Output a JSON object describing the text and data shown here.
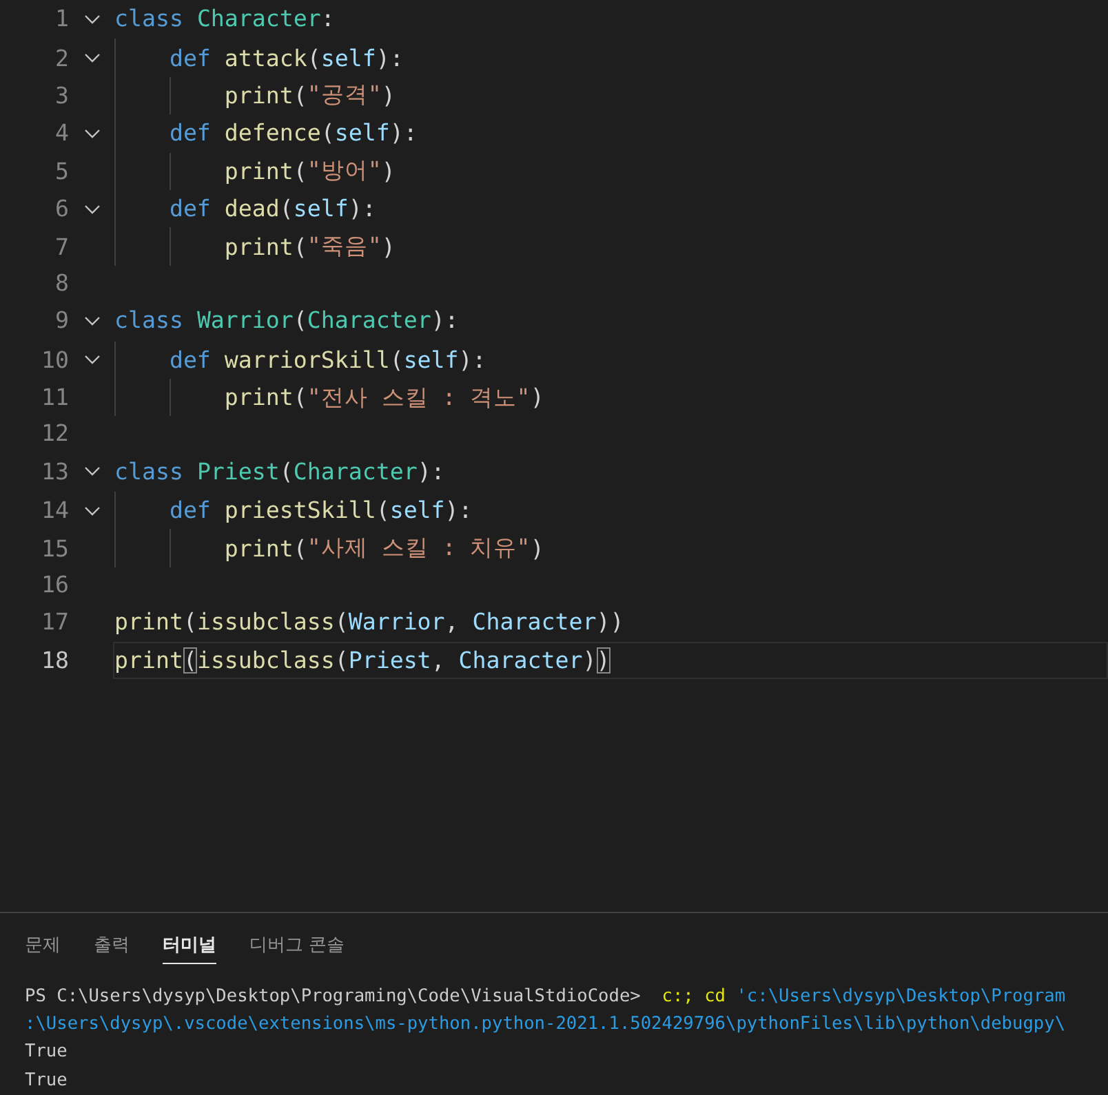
{
  "editor": {
    "lines": [
      {
        "number": "1",
        "kind": "class",
        "foldable": true,
        "active": false,
        "tokens": [
          {
            "kind": "keyword",
            "text": "class"
          },
          {
            "kind": "class",
            "text": " Character"
          },
          {
            "kind": "plain",
            "text": ":"
          }
        ]
      },
      {
        "number": "2",
        "kind": "method",
        "foldable": true,
        "active": false,
        "tokens": [
          {
            "kind": "keyword",
            "text": "def"
          },
          {
            "kind": "function",
            "text": " attack"
          },
          {
            "kind": "plain",
            "text": "("
          },
          {
            "kind": "param",
            "text": "self"
          },
          {
            "kind": "plain",
            "text": "):"
          }
        ]
      },
      {
        "number": "3",
        "kind": "body",
        "foldable": false,
        "active": false,
        "tokens": [
          {
            "kind": "function",
            "text": "print"
          },
          {
            "kind": "plain",
            "text": "("
          },
          {
            "kind": "string",
            "text": "\"공격\""
          },
          {
            "kind": "plain",
            "text": ")"
          }
        ]
      },
      {
        "number": "4",
        "kind": "method",
        "foldable": true,
        "active": false,
        "tokens": [
          {
            "kind": "keyword",
            "text": "def"
          },
          {
            "kind": "function",
            "text": " defence"
          },
          {
            "kind": "plain",
            "text": "("
          },
          {
            "kind": "param",
            "text": "self"
          },
          {
            "kind": "plain",
            "text": "):"
          }
        ]
      },
      {
        "number": "5",
        "kind": "body",
        "foldable": false,
        "active": false,
        "tokens": [
          {
            "kind": "function",
            "text": "print"
          },
          {
            "kind": "plain",
            "text": "("
          },
          {
            "kind": "string",
            "text": "\"방어\""
          },
          {
            "kind": "plain",
            "text": ")"
          }
        ]
      },
      {
        "number": "6",
        "kind": "method",
        "foldable": true,
        "active": false,
        "tokens": [
          {
            "kind": "keyword",
            "text": "def"
          },
          {
            "kind": "function",
            "text": " dead"
          },
          {
            "kind": "plain",
            "text": "("
          },
          {
            "kind": "param",
            "text": "self"
          },
          {
            "kind": "plain",
            "text": "):"
          }
        ]
      },
      {
        "number": "7",
        "kind": "body",
        "foldable": false,
        "active": false,
        "tokens": [
          {
            "kind": "function",
            "text": "print"
          },
          {
            "kind": "plain",
            "text": "("
          },
          {
            "kind": "string",
            "text": "\"죽음\""
          },
          {
            "kind": "plain",
            "text": ")"
          }
        ]
      },
      {
        "number": "8",
        "foldable": false,
        "active": false
      },
      {
        "number": "9",
        "kind": "class",
        "foldable": true,
        "active": false,
        "tokens": [
          {
            "kind": "keyword",
            "text": "class"
          },
          {
            "kind": "class",
            "text": " Warrior"
          },
          {
            "kind": "plain",
            "text": "("
          },
          {
            "kind": "class",
            "text": "Character"
          },
          {
            "kind": "plain",
            "text": "):"
          }
        ]
      },
      {
        "number": "10",
        "kind": "method",
        "foldable": true,
        "active": false,
        "tokens": [
          {
            "kind": "keyword",
            "text": "def"
          },
          {
            "kind": "function",
            "text": " warriorSkill"
          },
          {
            "kind": "plain",
            "text": "("
          },
          {
            "kind": "param",
            "text": "self"
          },
          {
            "kind": "plain",
            "text": "):"
          }
        ]
      },
      {
        "number": "11",
        "kind": "body",
        "foldable": false,
        "active": false,
        "tokens": [
          {
            "kind": "function",
            "text": "print"
          },
          {
            "kind": "plain",
            "text": "("
          },
          {
            "kind": "string",
            "text": "\"전사 스킬 : 격노\""
          },
          {
            "kind": "plain",
            "text": ")"
          }
        ]
      },
      {
        "number": "12",
        "foldable": false,
        "active": false
      },
      {
        "number": "13",
        "kind": "class",
        "foldable": true,
        "active": false,
        "tokens": [
          {
            "kind": "keyword",
            "text": "class"
          },
          {
            "kind": "class",
            "text": " Priest"
          },
          {
            "kind": "plain",
            "text": "("
          },
          {
            "kind": "class",
            "text": "Character"
          },
          {
            "kind": "plain",
            "text": "):"
          }
        ]
      },
      {
        "number": "14",
        "kind": "method",
        "foldable": true,
        "active": false,
        "tokens": [
          {
            "kind": "keyword",
            "text": "def"
          },
          {
            "kind": "function",
            "text": " priestSkill"
          },
          {
            "kind": "plain",
            "text": "("
          },
          {
            "kind": "param",
            "text": "self"
          },
          {
            "kind": "plain",
            "text": "):"
          }
        ]
      },
      {
        "number": "15",
        "kind": "body",
        "foldable": false,
        "active": false,
        "tokens": [
          {
            "kind": "function",
            "text": "print"
          },
          {
            "kind": "plain",
            "text": "("
          },
          {
            "kind": "string",
            "text": "\"사제 스킬 : 치유\""
          },
          {
            "kind": "plain",
            "text": ")"
          }
        ]
      },
      {
        "number": "16",
        "foldable": false,
        "active": false
      },
      {
        "number": "17",
        "kind": "statement",
        "foldable": false,
        "active": false,
        "tokens": [
          {
            "kind": "function",
            "text": "print"
          },
          {
            "kind": "plain",
            "text": "("
          },
          {
            "kind": "function",
            "text": "issubclass"
          },
          {
            "kind": "plain",
            "text": "("
          },
          {
            "kind": "param",
            "text": "Warrior"
          },
          {
            "kind": "plain",
            "text": ", "
          },
          {
            "kind": "param",
            "text": "Character"
          },
          {
            "kind": "plain",
            "text": "))"
          }
        ]
      },
      {
        "number": "18",
        "kind": "statement",
        "foldable": false,
        "active": true,
        "tokens": [
          {
            "kind": "function",
            "text": "print"
          },
          {
            "kind": "bracket-match",
            "text": "("
          },
          {
            "kind": "function",
            "text": "issubclass"
          },
          {
            "kind": "plain",
            "text": "("
          },
          {
            "kind": "param",
            "text": "Priest"
          },
          {
            "kind": "plain",
            "text": ", "
          },
          {
            "kind": "param",
            "text": "Character"
          },
          {
            "kind": "plain",
            "text": ")"
          },
          {
            "kind": "bracket-match",
            "text": ")"
          }
        ]
      }
    ]
  },
  "panel": {
    "tabs": [
      {
        "label": "문제",
        "selected": false
      },
      {
        "label": "출력",
        "selected": false
      },
      {
        "label": "터미널",
        "selected": true
      },
      {
        "label": "디버그 콘솔",
        "selected": false
      }
    ],
    "terminal": {
      "lines": [
        {
          "tokens": [
            {
              "kind": "plain",
              "text": "PS C:\\Users\\dysyp\\Desktop\\Programing\\Code\\VisualStdioCode>"
            },
            {
              "kind": "command",
              "text": "  c:;"
            },
            {
              "kind": "command",
              "text": " cd"
            },
            {
              "kind": "string",
              "text": " 'c:\\Users\\dysyp\\Desktop\\Program"
            }
          ]
        },
        {
          "tokens": [
            {
              "kind": "string",
              "text": ":\\Users\\dysyp\\.vscode\\extensions\\ms-python.python-2021.1.502429796\\pythonFiles\\lib\\python\\debugpy\\"
            }
          ]
        },
        {
          "tokens": [
            {
              "kind": "plain",
              "text": "True"
            }
          ]
        },
        {
          "tokens": [
            {
              "kind": "plain",
              "text": "True"
            }
          ]
        }
      ]
    }
  }
}
